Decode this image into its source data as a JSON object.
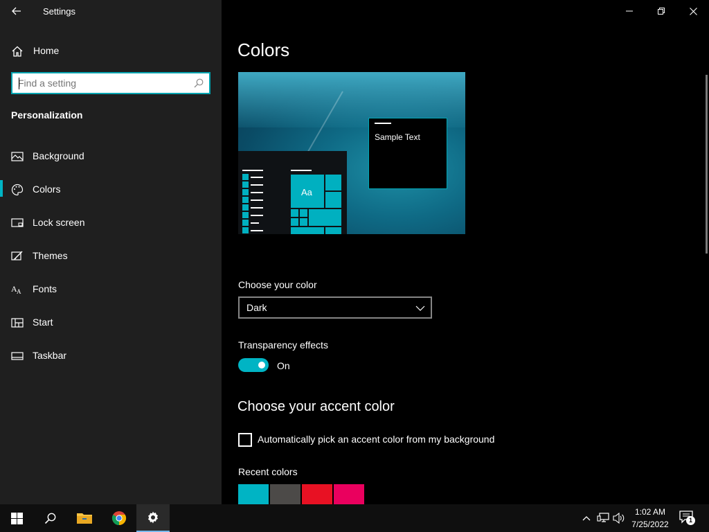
{
  "window": {
    "title": "Settings",
    "controls": [
      "minimize-icon",
      "restore-icon",
      "close-icon"
    ]
  },
  "sidebar": {
    "home_label": "Home",
    "search": {
      "placeholder": "Find a setting",
      "value": ""
    },
    "section_title": "Personalization",
    "items": [
      {
        "label": "Background",
        "icon": "picture-icon"
      },
      {
        "label": "Colors",
        "icon": "palette-icon",
        "active": true
      },
      {
        "label": "Lock screen",
        "icon": "lock-screen-icon"
      },
      {
        "label": "Themes",
        "icon": "brush-icon"
      },
      {
        "label": "Fonts",
        "icon": "font-icon"
      },
      {
        "label": "Start",
        "icon": "start-layout-icon"
      },
      {
        "label": "Taskbar",
        "icon": "taskbar-icon"
      }
    ]
  },
  "main": {
    "title": "Colors",
    "preview": {
      "sample_text": "Sample Text",
      "tile_label": "Aa"
    },
    "choose_color": {
      "label": "Choose your color",
      "value": "Dark"
    },
    "transparency": {
      "label": "Transparency effects",
      "state": "On",
      "enabled": true
    },
    "accent": {
      "title": "Choose your accent color",
      "auto_pick_label": "Automatically pick an accent color from my background",
      "auto_pick_checked": false,
      "recent_label": "Recent colors",
      "recent_colors": [
        "#00b4c4",
        "#4c4a48",
        "#e81123",
        "#ea005e"
      ]
    }
  },
  "taskbar": {
    "apps": [
      "windows-start-icon",
      "search-icon",
      "file-explorer-icon",
      "chrome-icon",
      "settings-gear-icon"
    ],
    "tray": [
      "chevron-up-icon",
      "network-icon",
      "volume-icon"
    ],
    "time": "1:02 AM",
    "date": "7/25/2022",
    "notification_count": "1"
  },
  "colors": {
    "accent": "#00b4c4",
    "sidebar_bg": "#1f1f1f",
    "main_bg": "#000000"
  }
}
